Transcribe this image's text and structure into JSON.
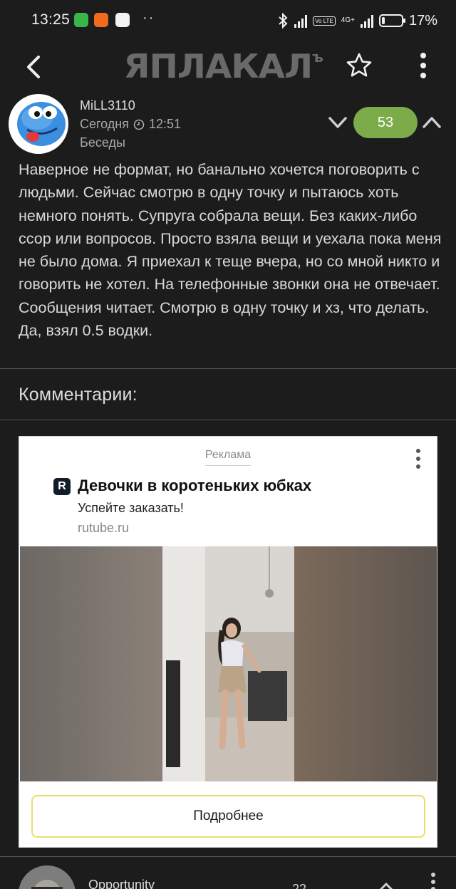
{
  "status_bar": {
    "time": "13:25",
    "dots": "··",
    "network": "4G+",
    "volte": "Vo LTE",
    "battery": "17%",
    "battery_level": 0.17
  },
  "app_bar": {
    "logo": "ЯПЛАКАЛ",
    "logo_suffix": "ъ",
    "back_icon": "chevron-left-icon",
    "favorite_icon": "star-icon",
    "menu_icon": "more-vertical-icon"
  },
  "post": {
    "username": "MiLL3110",
    "date_label": "Сегодня",
    "time": "12:51",
    "category": "Беседы",
    "score": "53",
    "score_color": "#7cab49",
    "text": "Наверное не формат, но банально хочется поговорить с людьми. Сейчас смотрю в одну точку и пытаюсь хоть немного понять. Супруга собрала вещи. Без каких-либо ссор или вопросов. Просто взяла вещи и уехала пока меня не было дома. Я приехал к теще вчера, но со мной никто и говорить не хотел. На телефонные звонки она не отвечает. Сообщения читает. Смотрю в одну точку и хз, что делать. Да, взял 0.5 водки."
  },
  "comments": {
    "title": "Комментарии:"
  },
  "ad": {
    "label": "Реклама",
    "logo_letter": "R",
    "title": "Девочки в коротеньких юбках",
    "subtitle": "Успейте заказать!",
    "domain": "rutube.ru",
    "button": "Подробнее",
    "button_border_color": "#e8df6b"
  },
  "next_comment": {
    "username": "Opportunity",
    "votes": "22"
  }
}
